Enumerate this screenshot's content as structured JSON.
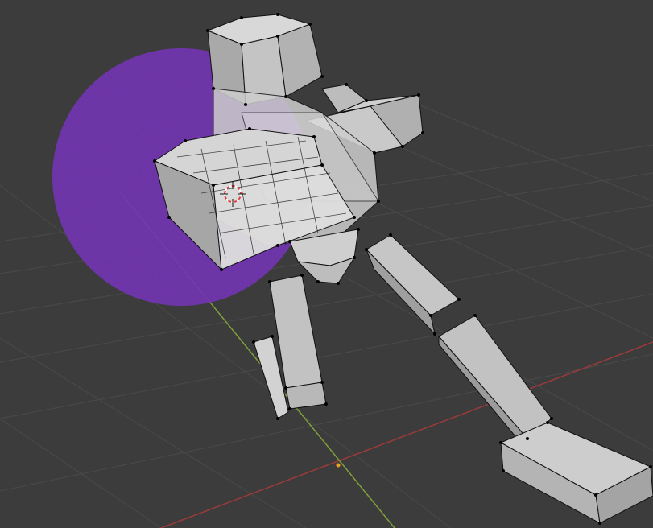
{
  "viewport": {
    "background_color": "#3c3c3c",
    "grid_color": "#4a4a4a",
    "x_axis_color": "#9b3a3a",
    "y_axis_color": "#7fa03a",
    "origin_color": "#f0a020"
  },
  "proportional_falloff": {
    "color": "#7a3ab8"
  },
  "mesh": {
    "face_color": "#c8c8c8",
    "edge_color": "#111111",
    "vertex_color": "#000000",
    "selected_face_color": "#dcdcdc"
  },
  "cursor_3d": {
    "icon": "3d-cursor-icon",
    "ring_color": "#e04040"
  }
}
